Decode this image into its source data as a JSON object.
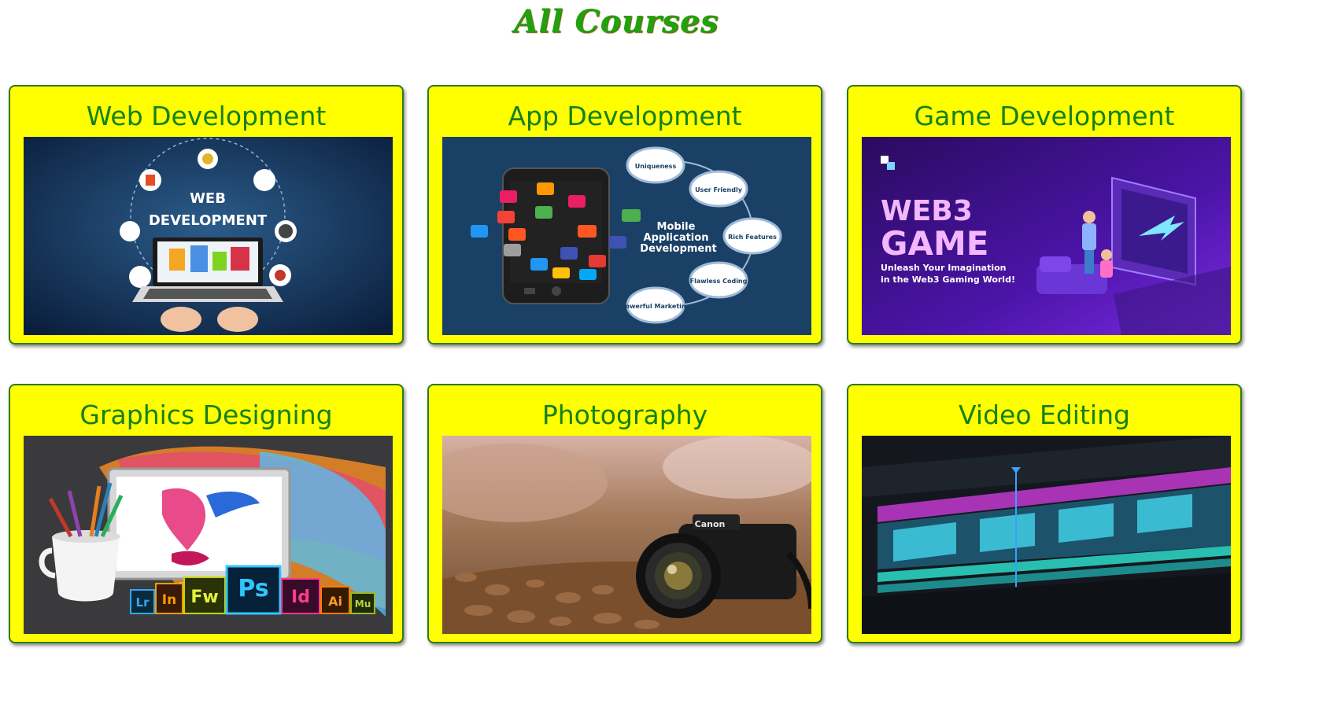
{
  "page": {
    "title": "All Courses"
  },
  "courses": [
    {
      "title": "Web Development",
      "image_text": {
        "line1": "WEB",
        "line2": "DEVELOPMENT"
      }
    },
    {
      "title": "App Development",
      "image_text": {
        "center1": "Mobile",
        "center2": "Application",
        "center3": "Development",
        "bubbles": [
          "Uniqueness",
          "User Friendly",
          "Rich Features",
          "Flawless Coding",
          "Powerful Marketing"
        ]
      }
    },
    {
      "title": "Game Development",
      "image_text": {
        "headline1": "WEB3",
        "headline2": "GAME",
        "tagline1": "Unleash Your Imagination",
        "tagline2": "in the Web3 Gaming World!"
      }
    },
    {
      "title": "Graphics Designing",
      "image_text": {
        "apps": [
          "Lr",
          "In",
          "Fw",
          "Ps",
          "Id",
          "Ai",
          "Mu"
        ]
      }
    },
    {
      "title": "Photography",
      "image_text": {
        "brand": "Canon"
      }
    },
    {
      "title": "Video Editing",
      "image_text": {}
    }
  ],
  "colors": {
    "card_background": "#ffff00",
    "card_title": "#15801a",
    "page_title": "#22a10e"
  }
}
